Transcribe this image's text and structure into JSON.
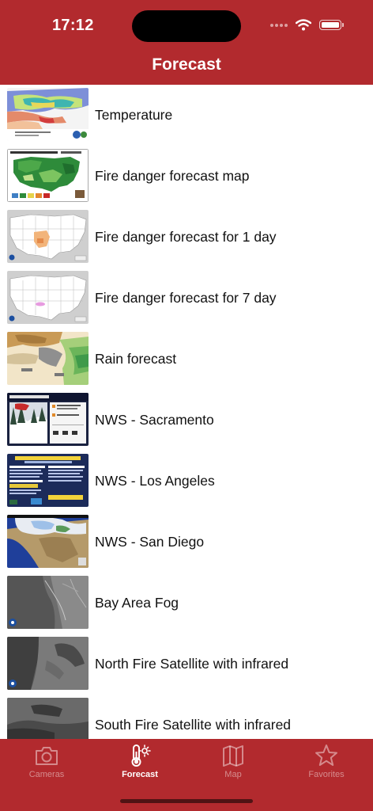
{
  "status_bar": {
    "time": "17:12"
  },
  "nav": {
    "title": "Forecast"
  },
  "items": [
    {
      "label": "Temperature",
      "thumb_icon": "temperature-map-thumbnail"
    },
    {
      "label": "Fire danger forecast map",
      "thumb_icon": "fire-danger-map-thumbnail"
    },
    {
      "label": "Fire danger forecast for 1 day",
      "thumb_icon": "fire-danger-1day-thumbnail"
    },
    {
      "label": "Fire danger forecast for 7 day",
      "thumb_icon": "fire-danger-7day-thumbnail"
    },
    {
      "label": "Rain forecast",
      "thumb_icon": "rain-forecast-thumbnail"
    },
    {
      "label": "NWS - Sacramento",
      "thumb_icon": "nws-sacramento-thumbnail"
    },
    {
      "label": "NWS - Los Angeles",
      "thumb_icon": "nws-los-angeles-thumbnail"
    },
    {
      "label": "NWS - San Diego",
      "thumb_icon": "nws-san-diego-thumbnail"
    },
    {
      "label": "Bay Area Fog",
      "thumb_icon": "bay-area-fog-thumbnail"
    },
    {
      "label": "North Fire Satellite with infrared",
      "thumb_icon": "north-satellite-thumbnail"
    },
    {
      "label": "South Fire Satellite with infrared",
      "thumb_icon": "south-satellite-thumbnail"
    }
  ],
  "tabs": [
    {
      "label": "Cameras",
      "icon": "camera-icon",
      "active": false
    },
    {
      "label": "Forecast",
      "icon": "thermometer-icon",
      "active": true
    },
    {
      "label": "Map",
      "icon": "map-icon",
      "active": false
    },
    {
      "label": "Favorites",
      "icon": "star-icon",
      "active": false
    }
  ],
  "colors": {
    "brand_red": "#b22a2e",
    "background": "#ffffff",
    "text": "#111111"
  }
}
